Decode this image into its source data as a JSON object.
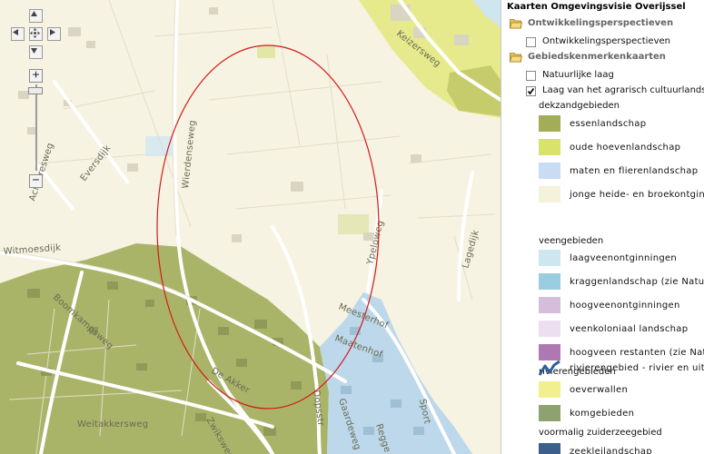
{
  "map": {
    "streets": {
      "keizersweg": "Keizersweg",
      "eversdijk": "Eversdijk",
      "achteresweg": "Achteresweg",
      "wierdenseweg": "Wierdenseweg",
      "witmoesdijk": "Witmoesdijk",
      "boomkampsweg": "Boomkampsweg",
      "ypeloweg": "Ypeloweg",
      "lagedijk": "Lagedijk",
      "meesterhof": "Meesterhof",
      "maatenhof": "Maatenhof",
      "de_akker": "De Akker",
      "weitakkersweg": "Weitakkersweg",
      "zwiksweg": "Zwiksweg",
      "dopsstraat": "Dopsstr",
      "gaardeweg": "Gaardeweg",
      "regge": "Regge",
      "sport": "Sport"
    },
    "controls": {
      "pan_up": "pan up",
      "pan_left": "pan left",
      "pan_home": "pan home",
      "pan_right": "pan right",
      "pan_down": "pan down",
      "zoom_in": "+",
      "zoom_out": "−"
    }
  },
  "legend": {
    "title": "Kaarten Omgevingsvisie Overijssel",
    "folders": [
      {
        "label": "Ontwikkelingsperspectieven",
        "layers": [
          {
            "label": "Ontwikkelingsperspectieven",
            "checked": false
          }
        ]
      },
      {
        "label": "Gebiedskenmerkenkaarten",
        "layers": [
          {
            "label": "Natuurlijke laag",
            "checked": false
          },
          {
            "label": "Laag van het agrarisch cultuurlandschap",
            "checked": true
          }
        ]
      }
    ],
    "groups": [
      {
        "label": "dekzandgebieden",
        "items": [
          {
            "label": "essenlandschap",
            "color": "#a3ac56",
            "icon": "swatch"
          },
          {
            "label": "oude hoevenlandschap",
            "color": "#d9e36c",
            "icon": "swatch"
          },
          {
            "label": "maten en flierenlandschap",
            "color": "#cadcf4",
            "icon": "swatch"
          },
          {
            "label": "jonge heide- en broekontginningslandschap",
            "color": "#f4f2da",
            "icon": "swatch"
          }
        ]
      },
      {
        "label": "veengebieden",
        "items": [
          {
            "label": "laagveenontginningen",
            "color": "#cde6ef",
            "icon": "swatch"
          },
          {
            "label": "kraggenlandschap (zie Natuurlijke laag)",
            "color": "#9acde0",
            "icon": "swatch"
          },
          {
            "label": "hoogveenontginningen",
            "color": "#d6bddc",
            "icon": "swatch"
          },
          {
            "label": "veenkoloniaal landschap",
            "color": "#ece0f0",
            "icon": "swatch"
          },
          {
            "label": "hoogveen restanten (zie Natuurlijke laag)",
            "color": "#ae78b2",
            "icon": "swatch"
          }
        ]
      },
      {
        "label": "rivierengebieden",
        "items": [
          {
            "label": "rivierengebied - rivier en uiterwaarden",
            "color": "#2e5f9a",
            "icon": "river-line-icon"
          },
          {
            "label": "oeverwallen",
            "color": "#f1ef8e",
            "icon": "swatch"
          },
          {
            "label": "komgebieden",
            "color": "#8da26f",
            "icon": "swatch"
          }
        ]
      },
      {
        "label": "voormalig zuiderzeegebied",
        "items": [
          {
            "label": "zeekleilandschap",
            "color": "#3b5f8a",
            "icon": "swatch"
          }
        ]
      }
    ]
  }
}
